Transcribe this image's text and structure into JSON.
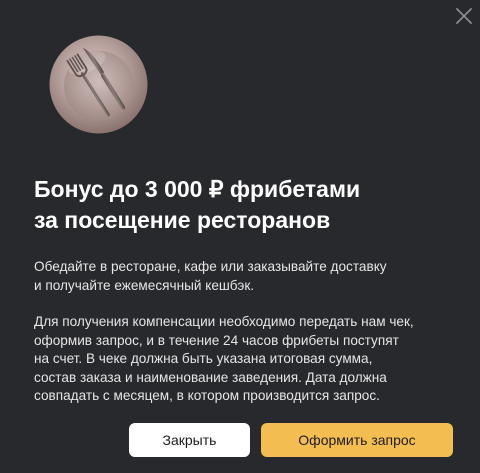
{
  "dialog": {
    "title_line1": "Бонус до 3 000 ₽ фрибетами",
    "title_line2": "за посещение ресторанов",
    "paragraph1_line1": "Обедайте в ресторане, кафе или заказывайте доставку",
    "paragraph1_line2": "и получайте ежемесячный кешбэк.",
    "paragraph2_line1": "Для получения компенсации необходимо передать нам чек,",
    "paragraph2_line2": "оформив запрос, и в течение 24 часов фрибеты поступят",
    "paragraph2_line3": "на счет. В чеке должна быть указана итоговая сумма,",
    "paragraph2_line4": "состав заказа и наименование заведения. Дата должна",
    "paragraph2_line5": "совпадать с месяцем, в котором производится запрос.",
    "close_label": "Закрыть",
    "submit_label": "Оформить запрос"
  },
  "icons": {
    "close": "close-icon",
    "illustration": "plate-fork-knife-icon"
  },
  "colors": {
    "background": "#28292c",
    "primary_button": "#f3bd52",
    "secondary_button": "#ffffff",
    "text": "#ffffff"
  }
}
